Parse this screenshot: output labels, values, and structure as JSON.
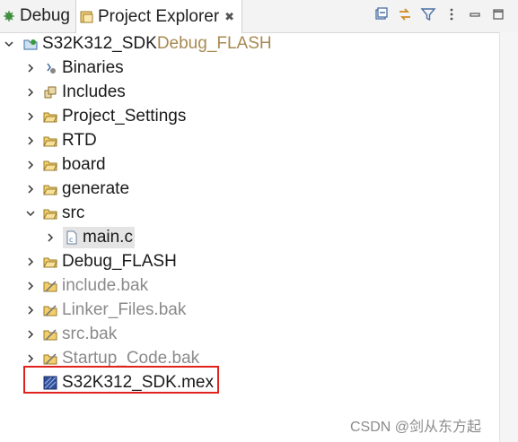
{
  "tabs": {
    "debug_label": "Debug",
    "explorer_label": "Project Explorer",
    "explorer_close": "✖"
  },
  "toolbar_icons": [
    "collapse-all-icon",
    "link-with-editor-icon",
    "filter-icon",
    "view-menu-icon",
    "minimize-icon",
    "maximize-icon"
  ],
  "tree": {
    "project": {
      "name": "S32K312_SDK",
      "decoration": " Debug_FLASH"
    },
    "items": [
      {
        "label": "Binaries",
        "icon": "binaries-icon"
      },
      {
        "label": "Includes",
        "icon": "includes-icon"
      },
      {
        "label": "Project_Settings",
        "icon": "folder-icon"
      },
      {
        "label": "RTD",
        "icon": "folder-icon"
      },
      {
        "label": "board",
        "icon": "folder-icon"
      },
      {
        "label": "generate",
        "icon": "folder-icon"
      },
      {
        "label": "src",
        "icon": "folder-icon"
      },
      {
        "label": "main.c",
        "icon": "c-file-icon"
      },
      {
        "label": "Debug_FLASH",
        "icon": "folder-icon"
      },
      {
        "label": "include.bak",
        "icon": "folder-icon"
      },
      {
        "label": "Linker_Files.bak",
        "icon": "folder-icon"
      },
      {
        "label": "src.bak",
        "icon": "folder-icon"
      },
      {
        "label": "Startup_Code.bak",
        "icon": "folder-icon"
      },
      {
        "label": "S32K312_SDK.mex",
        "icon": "mex-file-icon"
      }
    ]
  },
  "watermark": "CSDN @剑从东方起",
  "colors": {
    "highlight_box": "#e1221c",
    "decoration": "#a88a52",
    "dim_text": "#8a8a8a"
  }
}
